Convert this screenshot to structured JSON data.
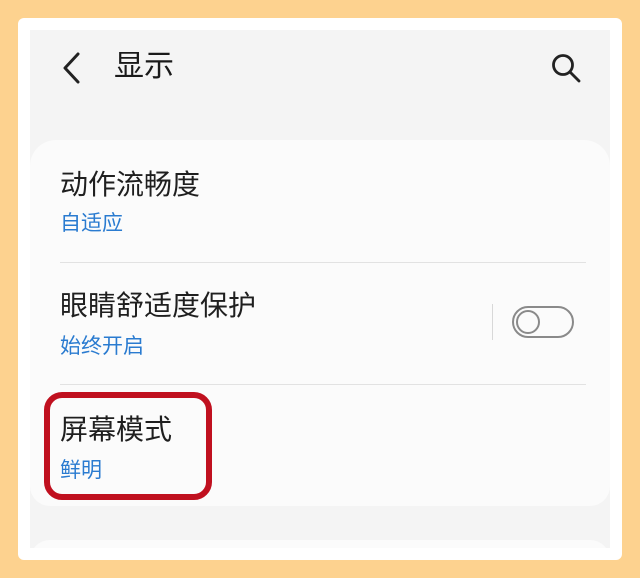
{
  "header": {
    "title": "显示",
    "back_icon": "chevron-left-icon",
    "search_icon": "search-icon"
  },
  "settings": {
    "items": [
      {
        "title": "动作流畅度",
        "subtitle": "自适应"
      },
      {
        "title": "眼睛舒适度保护",
        "subtitle": "始终开启",
        "toggle_on": false
      },
      {
        "title": "屏幕模式",
        "subtitle": "鲜明"
      }
    ]
  },
  "colors": {
    "background": "#fdd28f",
    "accent_blue": "#2a7bd0",
    "highlight_red": "#c0101f"
  }
}
